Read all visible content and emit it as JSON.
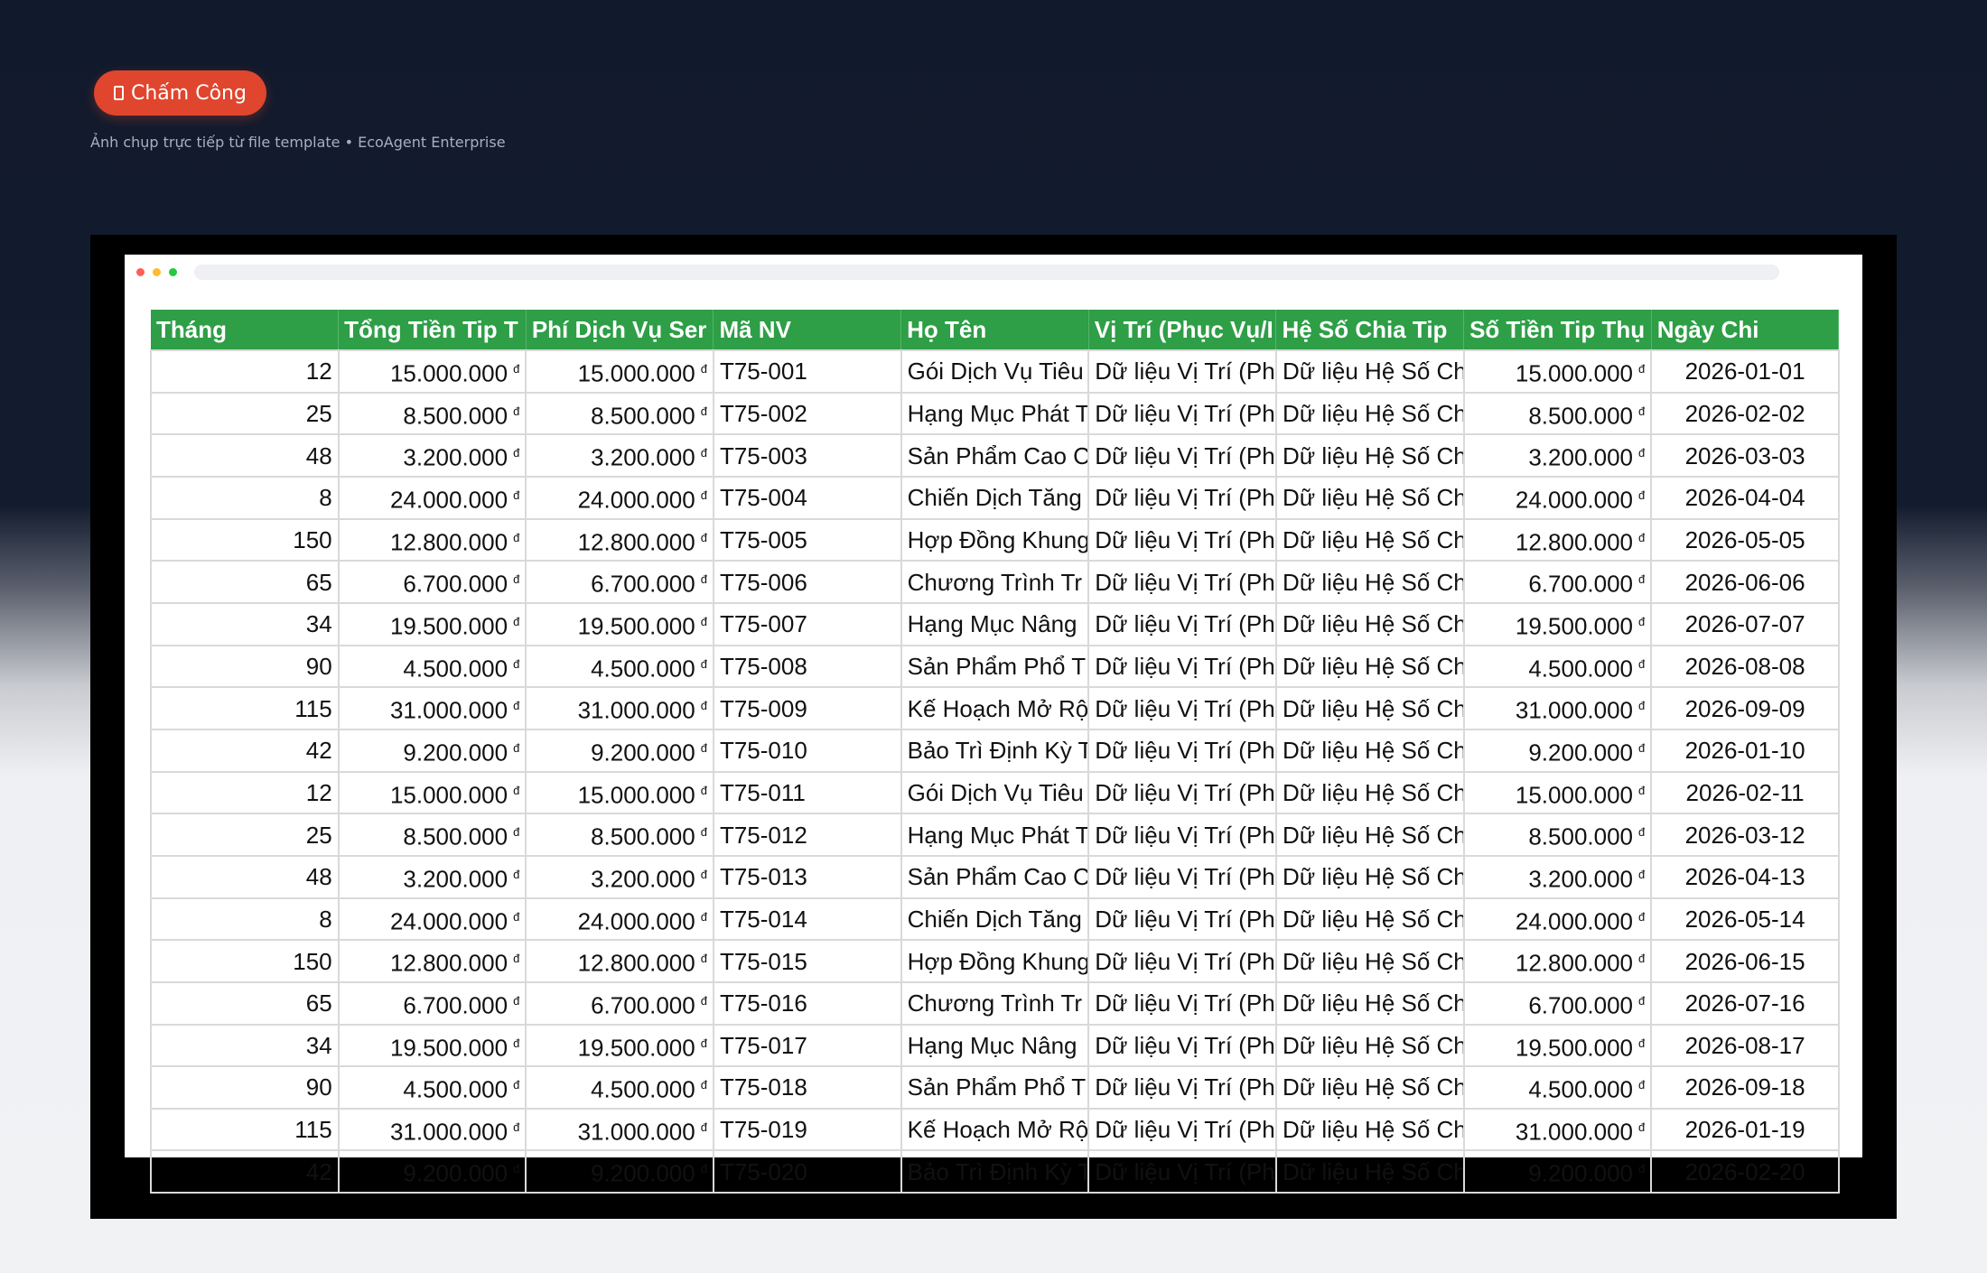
{
  "header": {
    "badge_icon": "document-icon",
    "badge_label": "Chấm Công",
    "subtitle": "Ảnh chụp trực tiếp từ file template • EcoAgent Enterprise"
  },
  "table": {
    "columns": [
      "Tháng",
      "Tổng Tiền Tip T",
      "Phí Dịch Vụ Ser",
      "Mã NV",
      "Họ Tên",
      "Vị Trí (Phục Vụ/I",
      "Hệ Số Chia Tip",
      "Số Tiền Tip Thụ",
      "Ngày Chi"
    ],
    "currency_symbol": "đ",
    "rows": [
      {
        "thang": "12",
        "tong": "15.000.000",
        "phi": "15.000.000",
        "ma": "T75-001",
        "ten": "Gói Dịch Vụ Tiêu",
        "vitri": "Dữ liệu Vị Trí (Ph",
        "heso": "Dữ liệu Hệ Số Ch",
        "sotien": "15.000.000",
        "ngay": "2026-01-01"
      },
      {
        "thang": "25",
        "tong": "8.500.000",
        "phi": "8.500.000",
        "ma": "T75-002",
        "ten": "Hạng Mục Phát T",
        "vitri": "Dữ liệu Vị Trí (Ph",
        "heso": "Dữ liệu Hệ Số Ch",
        "sotien": "8.500.000",
        "ngay": "2026-02-02"
      },
      {
        "thang": "48",
        "tong": "3.200.000",
        "phi": "3.200.000",
        "ma": "T75-003",
        "ten": "Sản Phẩm Cao C",
        "vitri": "Dữ liệu Vị Trí (Ph",
        "heso": "Dữ liệu Hệ Số Ch",
        "sotien": "3.200.000",
        "ngay": "2026-03-03"
      },
      {
        "thang": "8",
        "tong": "24.000.000",
        "phi": "24.000.000",
        "ma": "T75-004",
        "ten": "Chiến Dịch Tăng",
        "vitri": "Dữ liệu Vị Trí (Ph",
        "heso": "Dữ liệu Hệ Số Ch",
        "sotien": "24.000.000",
        "ngay": "2026-04-04"
      },
      {
        "thang": "150",
        "tong": "12.800.000",
        "phi": "12.800.000",
        "ma": "T75-005",
        "ten": "Hợp Đồng Khung",
        "vitri": "Dữ liệu Vị Trí (Ph",
        "heso": "Dữ liệu Hệ Số Ch",
        "sotien": "12.800.000",
        "ngay": "2026-05-05"
      },
      {
        "thang": "65",
        "tong": "6.700.000",
        "phi": "6.700.000",
        "ma": "T75-006",
        "ten": "Chương Trình Tr",
        "vitri": "Dữ liệu Vị Trí (Ph",
        "heso": "Dữ liệu Hệ Số Ch",
        "sotien": "6.700.000",
        "ngay": "2026-06-06"
      },
      {
        "thang": "34",
        "tong": "19.500.000",
        "phi": "19.500.000",
        "ma": "T75-007",
        "ten": "Hạng Mục Nâng",
        "vitri": "Dữ liệu Vị Trí (Ph",
        "heso": "Dữ liệu Hệ Số Ch",
        "sotien": "19.500.000",
        "ngay": "2026-07-07"
      },
      {
        "thang": "90",
        "tong": "4.500.000",
        "phi": "4.500.000",
        "ma": "T75-008",
        "ten": "Sản Phẩm Phổ T",
        "vitri": "Dữ liệu Vị Trí (Ph",
        "heso": "Dữ liệu Hệ Số Ch",
        "sotien": "4.500.000",
        "ngay": "2026-08-08"
      },
      {
        "thang": "115",
        "tong": "31.000.000",
        "phi": "31.000.000",
        "ma": "T75-009",
        "ten": "Kế Hoạch Mở Rộ",
        "vitri": "Dữ liệu Vị Trí (Ph",
        "heso": "Dữ liệu Hệ Số Ch",
        "sotien": "31.000.000",
        "ngay": "2026-09-09"
      },
      {
        "thang": "42",
        "tong": "9.200.000",
        "phi": "9.200.000",
        "ma": "T75-010",
        "ten": "Bảo Trì Định Kỳ T",
        "vitri": "Dữ liệu Vị Trí (Ph",
        "heso": "Dữ liệu Hệ Số Ch",
        "sotien": "9.200.000",
        "ngay": "2026-01-10"
      },
      {
        "thang": "12",
        "tong": "15.000.000",
        "phi": "15.000.000",
        "ma": "T75-011",
        "ten": "Gói Dịch Vụ Tiêu",
        "vitri": "Dữ liệu Vị Trí (Ph",
        "heso": "Dữ liệu Hệ Số Ch",
        "sotien": "15.000.000",
        "ngay": "2026-02-11"
      },
      {
        "thang": "25",
        "tong": "8.500.000",
        "phi": "8.500.000",
        "ma": "T75-012",
        "ten": "Hạng Mục Phát T",
        "vitri": "Dữ liệu Vị Trí (Ph",
        "heso": "Dữ liệu Hệ Số Ch",
        "sotien": "8.500.000",
        "ngay": "2026-03-12"
      },
      {
        "thang": "48",
        "tong": "3.200.000",
        "phi": "3.200.000",
        "ma": "T75-013",
        "ten": "Sản Phẩm Cao C",
        "vitri": "Dữ liệu Vị Trí (Ph",
        "heso": "Dữ liệu Hệ Số Ch",
        "sotien": "3.200.000",
        "ngay": "2026-04-13"
      },
      {
        "thang": "8",
        "tong": "24.000.000",
        "phi": "24.000.000",
        "ma": "T75-014",
        "ten": "Chiến Dịch Tăng",
        "vitri": "Dữ liệu Vị Trí (Ph",
        "heso": "Dữ liệu Hệ Số Ch",
        "sotien": "24.000.000",
        "ngay": "2026-05-14"
      },
      {
        "thang": "150",
        "tong": "12.800.000",
        "phi": "12.800.000",
        "ma": "T75-015",
        "ten": "Hợp Đồng Khung",
        "vitri": "Dữ liệu Vị Trí (Ph",
        "heso": "Dữ liệu Hệ Số Ch",
        "sotien": "12.800.000",
        "ngay": "2026-06-15"
      },
      {
        "thang": "65",
        "tong": "6.700.000",
        "phi": "6.700.000",
        "ma": "T75-016",
        "ten": "Chương Trình Tr",
        "vitri": "Dữ liệu Vị Trí (Ph",
        "heso": "Dữ liệu Hệ Số Ch",
        "sotien": "6.700.000",
        "ngay": "2026-07-16"
      },
      {
        "thang": "34",
        "tong": "19.500.000",
        "phi": "19.500.000",
        "ma": "T75-017",
        "ten": "Hạng Mục Nâng",
        "vitri": "Dữ liệu Vị Trí (Ph",
        "heso": "Dữ liệu Hệ Số Ch",
        "sotien": "19.500.000",
        "ngay": "2026-08-17"
      },
      {
        "thang": "90",
        "tong": "4.500.000",
        "phi": "4.500.000",
        "ma": "T75-018",
        "ten": "Sản Phẩm Phổ T",
        "vitri": "Dữ liệu Vị Trí (Ph",
        "heso": "Dữ liệu Hệ Số Ch",
        "sotien": "4.500.000",
        "ngay": "2026-09-18"
      },
      {
        "thang": "115",
        "tong": "31.000.000",
        "phi": "31.000.000",
        "ma": "T75-019",
        "ten": "Kế Hoạch Mở Rộ",
        "vitri": "Dữ liệu Vị Trí (Ph",
        "heso": "Dữ liệu Hệ Số Ch",
        "sotien": "31.000.000",
        "ngay": "2026-01-19"
      },
      {
        "thang": "42",
        "tong": "9.200.000",
        "phi": "9.200.000",
        "ma": "T75-020",
        "ten": "Bảo Trì Định Kỳ T",
        "vitri": "Dữ liệu Vị Trí (Ph",
        "heso": "Dữ liệu Hệ Số Ch",
        "sotien": "9.200.000",
        "ngay": "2026-02-20"
      }
    ]
  },
  "colors": {
    "header_green": "#2e9e47",
    "badge_red": "#e0452e",
    "background_navy": "#111a2c"
  }
}
